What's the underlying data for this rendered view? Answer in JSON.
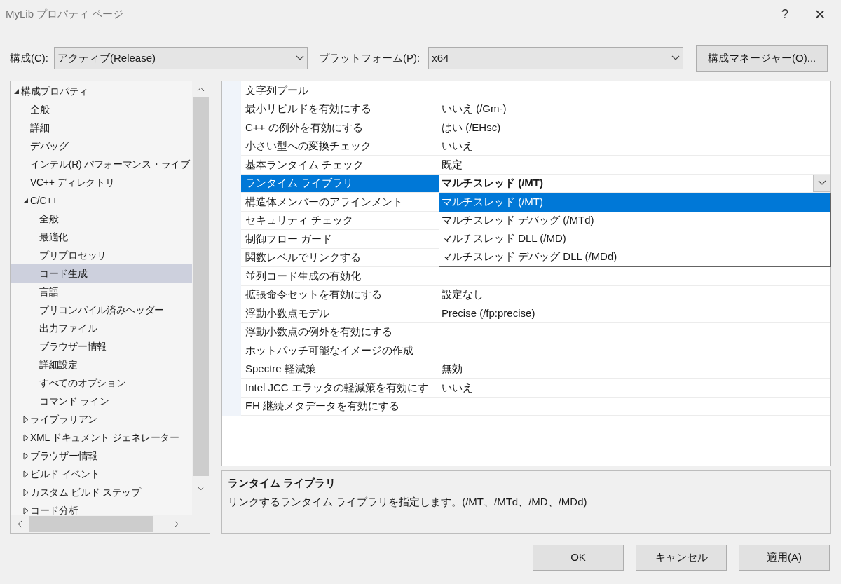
{
  "window": {
    "title": "MyLib プロパティ ページ",
    "help": "?",
    "close": "×"
  },
  "toolbar": {
    "config_label": "構成(C):",
    "config_value": "アクティブ(Release)",
    "platform_label": "プラットフォーム(P):",
    "platform_value": "x64",
    "manager_button": "構成マネージャー(O)..."
  },
  "tree": [
    {
      "label": "構成プロパティ",
      "expanded": true,
      "selected": false,
      "children": [
        {
          "label": "全般",
          "selected": false
        },
        {
          "label": "詳細",
          "selected": false
        },
        {
          "label": "デバッグ",
          "selected": false
        },
        {
          "label": "インテル(R) パフォーマンス・ライブ",
          "selected": false
        },
        {
          "label": "VC++ ディレクトリ",
          "selected": false
        },
        {
          "label": "C/C++",
          "expanded": true,
          "selected": false,
          "children": [
            {
              "label": "全般",
              "selected": false
            },
            {
              "label": "最適化",
              "selected": false
            },
            {
              "label": "プリプロセッサ",
              "selected": false
            },
            {
              "label": "コード生成",
              "selected": true
            },
            {
              "label": "言語",
              "selected": false
            },
            {
              "label": "プリコンパイル済みヘッダー",
              "selected": false
            },
            {
              "label": "出力ファイル",
              "selected": false
            },
            {
              "label": "ブラウザー情報",
              "selected": false
            },
            {
              "label": "詳細設定",
              "selected": false
            },
            {
              "label": "すべてのオプション",
              "selected": false
            },
            {
              "label": "コマンド ライン",
              "selected": false
            }
          ]
        },
        {
          "label": "ライブラリアン",
          "expanded": false,
          "selected": false
        },
        {
          "label": "XML ドキュメント ジェネレーター",
          "expanded": false,
          "selected": false
        },
        {
          "label": "ブラウザー情報",
          "expanded": false,
          "selected": false
        },
        {
          "label": "ビルド イベント",
          "expanded": false,
          "selected": false
        },
        {
          "label": "カスタム ビルド ステップ",
          "expanded": false,
          "selected": false
        },
        {
          "label": "コード分析",
          "expanded": false,
          "selected": false
        }
      ]
    }
  ],
  "properties": [
    {
      "name": "文字列プール",
      "selected": false
    },
    {
      "name": "最小リビルドを有効にする",
      "value": "いいえ (/Gm-)",
      "selected": false
    },
    {
      "name": "C++ の例外を有効にする",
      "value": "はい (/EHsc)",
      "selected": false
    },
    {
      "name": "小さい型への変換チェック",
      "value": "いいえ",
      "selected": false
    },
    {
      "name": "基本ランタイム チェック",
      "value": "既定",
      "selected": false
    },
    {
      "name": "ランタイム ライブラリ",
      "value": "マルチスレッド (/MT)",
      "selected": true,
      "options": [
        {
          "label": "マルチスレッド (/MT)",
          "selected": true
        },
        {
          "label": "マルチスレッド デバッグ (/MTd)",
          "selected": false
        },
        {
          "label": "マルチスレッド DLL (/MD)",
          "selected": false
        },
        {
          "label": "マルチスレッド デバッグ DLL (/MDd)",
          "selected": false
        }
      ]
    },
    {
      "name": "構造体メンバーのアラインメント",
      "selected": false
    },
    {
      "name": "セキュリティ チェック",
      "selected": false
    },
    {
      "name": "制御フロー ガード",
      "selected": false
    },
    {
      "name": "関数レベルでリンクする",
      "selected": false
    },
    {
      "name": "並列コード生成の有効化",
      "selected": false
    },
    {
      "name": "拡張命令セットを有効にする",
      "value": "設定なし",
      "selected": false
    },
    {
      "name": "浮動小数点モデル",
      "value": "Precise (/fp:precise)",
      "selected": false
    },
    {
      "name": "浮動小数点の例外を有効にする",
      "selected": false
    },
    {
      "name": "ホットパッチ可能なイメージの作成",
      "selected": false
    },
    {
      "name": "Spectre 軽減策",
      "value": "無効",
      "selected": false
    },
    {
      "name": "Intel JCC エラッタの軽減策を有効にす",
      "value": "いいえ",
      "selected": false
    },
    {
      "name": "EH 継続メタデータを有効にする",
      "selected": false
    }
  ],
  "description": {
    "title": "ランタイム ライブラリ",
    "text": "リンクするランタイム ライブラリを指定します。(/MT、/MTd、/MD、/MDd)"
  },
  "buttons": [
    "OK",
    "キャンセル",
    "適用(A)"
  ]
}
